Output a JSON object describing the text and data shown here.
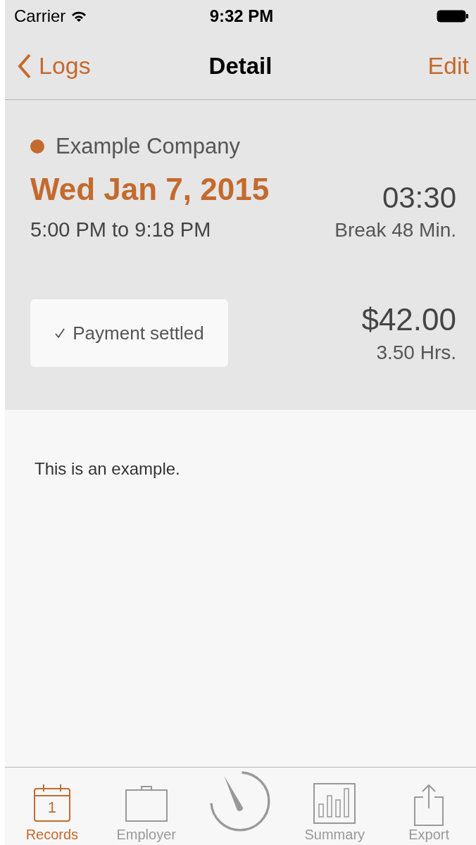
{
  "status_bar": {
    "carrier": "Carrier",
    "time": "9:32 PM"
  },
  "nav": {
    "back": "Logs",
    "title": "Detail",
    "action": "Edit"
  },
  "entry": {
    "company": {
      "name": "Example Company",
      "color": "#c46a2e"
    },
    "date": "Wed Jan 7, 2015",
    "time_range": "5:00 PM to 9:18 PM",
    "duration": "03:30",
    "break": "Break 48 Min.",
    "payment": {
      "label": "Payment settled",
      "checked": true
    },
    "amount": "$42.00",
    "hours": "3.50 Hrs."
  },
  "notes": "This is an example.",
  "tabs": [
    {
      "kind": "calendar",
      "label": "Records",
      "day": "1",
      "selected": true
    },
    {
      "kind": "briefcase",
      "label": "Employer",
      "selected": false
    },
    {
      "kind": "timer",
      "selected": false
    },
    {
      "kind": "chart",
      "label": "Summary",
      "selected": false
    },
    {
      "kind": "share",
      "label": "Export",
      "selected": false
    }
  ]
}
